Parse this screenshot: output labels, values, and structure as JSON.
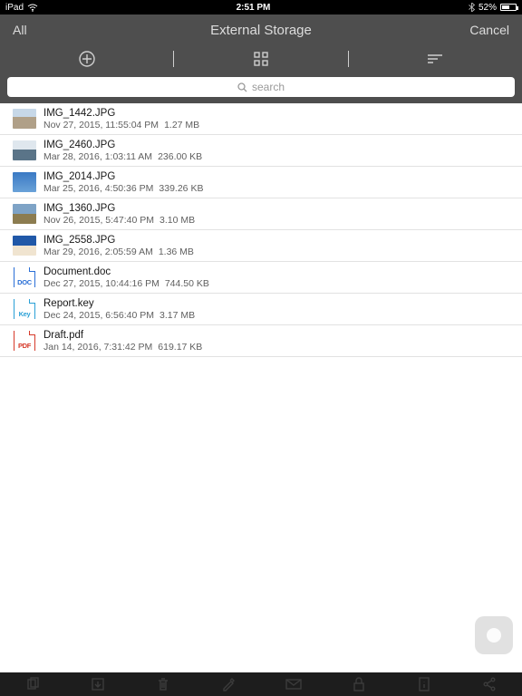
{
  "status": {
    "device": "iPad",
    "time": "2:51 PM",
    "battery": "52%"
  },
  "nav": {
    "left": "All",
    "title": "External Storage",
    "right": "Cancel"
  },
  "search": {
    "placeholder": "search"
  },
  "files": [
    {
      "name": "IMG_1442.JPG",
      "date": "Nov 27, 2015, 11:55:04 PM",
      "size": "1.27 MB",
      "thumb": "sky1"
    },
    {
      "name": "IMG_2460.JPG",
      "date": "Mar 28, 2016, 1:03:11 AM",
      "size": "236.00 KB",
      "thumb": "sea"
    },
    {
      "name": "IMG_2014.JPG",
      "date": "Mar 25, 2016, 4:50:36 PM",
      "size": "339.26 KB",
      "thumb": "blue"
    },
    {
      "name": "IMG_1360.JPG",
      "date": "Nov 26, 2015, 5:47:40 PM",
      "size": "3.10 MB",
      "thumb": "land"
    },
    {
      "name": "IMG_2558.JPG",
      "date": "Mar 29, 2016, 2:05:59 AM",
      "size": "1.36 MB",
      "thumb": "strip"
    },
    {
      "name": "Document.doc",
      "date": "Dec 27, 2015, 10:44:16 PM",
      "size": "744.50 KB",
      "thumb": "doc"
    },
    {
      "name": "Report.key",
      "date": "Dec 24, 2015, 6:56:40 PM",
      "size": "3.17 MB",
      "thumb": "key"
    },
    {
      "name": "Draft.pdf",
      "date": "Jan 14, 2016, 7:31:42 PM",
      "size": "619.17 KB",
      "thumb": "pdf"
    }
  ],
  "docLabels": {
    "doc": "DOC",
    "key": "Key",
    "pdf": "PDF"
  }
}
